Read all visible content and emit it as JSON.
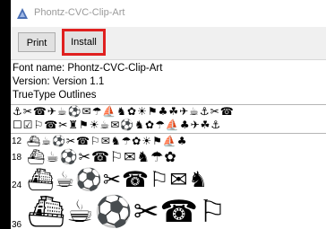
{
  "window": {
    "title": "Phontz-CVC-Clip-Art"
  },
  "toolbar": {
    "print_label": "Print",
    "install_label": "Install"
  },
  "font_info": {
    "name_line": "Font name: Phontz-CVC-Clip-Art",
    "version_line": "Version: Version 1.1",
    "type_line": "TrueType Outlines"
  },
  "sample_rows": [
    {
      "size": "",
      "glyphs": "⚓✂☎✈☕⚽✉☂⛵♞✿☀⚑♣☘✈☕⚓✂☎"
    },
    {
      "size": "",
      "glyphs": "☐☑⚐☎✂♜⚑☀☕✉⚽♞✿☂⛵♣✈☘⚓"
    },
    {
      "size": "12",
      "glyphs": "⛴☕⚽✂☎⚐✉♞☂✿☀⚑⛵♣"
    },
    {
      "size": "18",
      "glyphs": "⛴☕⚽✂☎⚐✉♞☂✿"
    },
    {
      "size": "24",
      "glyphs": "⛴☕⚽✂☎⚐✉♞"
    },
    {
      "size": "36",
      "glyphs": "⛴☕⚽✂☎⚐"
    }
  ],
  "colors": {
    "highlight": "#e0201f",
    "titlebar_bg": "#ffffff",
    "toolbar_bg": "#f0f0f0"
  },
  "icons": {
    "app_icon": "font-app-icon"
  }
}
